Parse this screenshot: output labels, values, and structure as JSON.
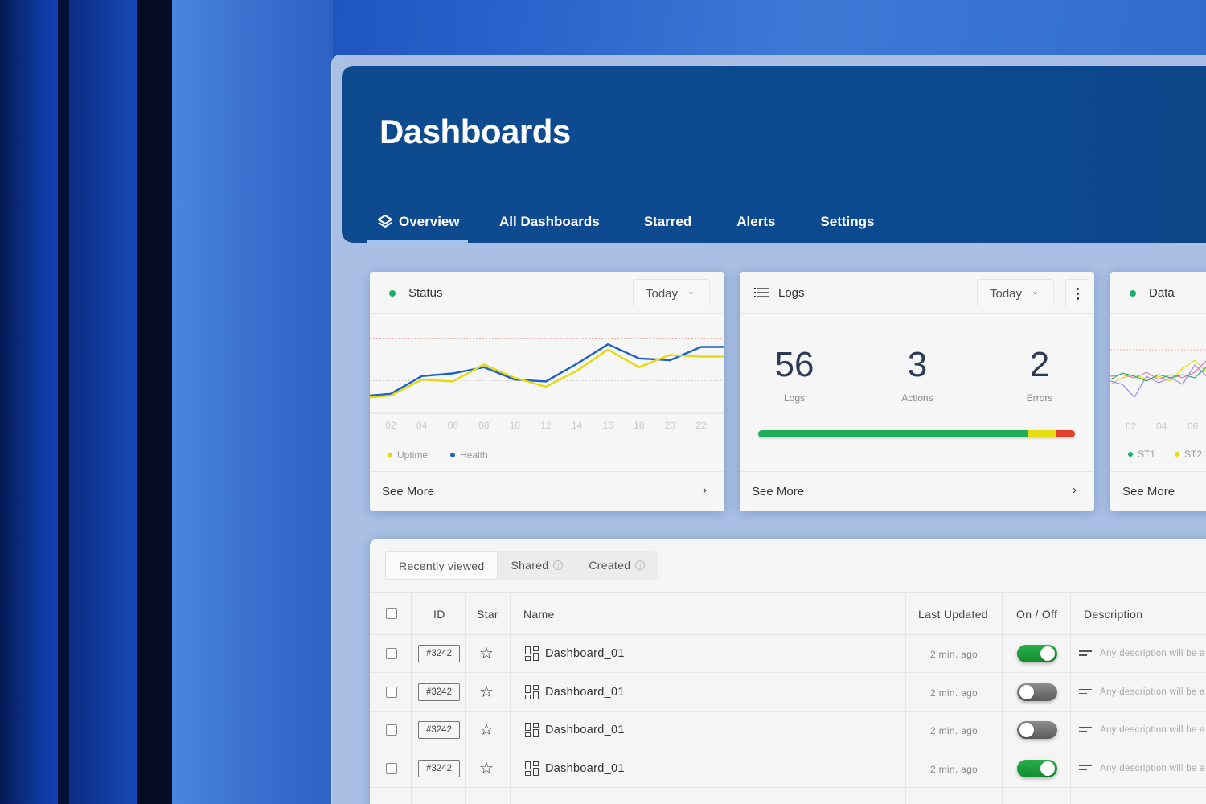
{
  "header": {
    "title": "Dashboards",
    "tabs": [
      {
        "label": "Overview"
      },
      {
        "label": "All Dashboards"
      },
      {
        "label": "Starred"
      },
      {
        "label": "Alerts"
      },
      {
        "label": "Settings"
      }
    ]
  },
  "cards": {
    "status": {
      "title": "Status",
      "range": "Today",
      "x_ticks": [
        "02",
        "04",
        "06",
        "08",
        "10",
        "12",
        "14",
        "16",
        "18",
        "20",
        "22"
      ],
      "legend": [
        "Uptime",
        "Health"
      ],
      "see_more": "See More"
    },
    "logs": {
      "title": "Logs",
      "range": "Today",
      "stats": [
        {
          "value": "56",
          "label": "Logs"
        },
        {
          "value": "3",
          "label": "Actions"
        },
        {
          "value": "2",
          "label": "Errors"
        }
      ],
      "progress": {
        "green": 0.85,
        "yellow": 0.09,
        "red": 0.06
      },
      "see_more": "See More"
    },
    "data": {
      "title": "Data",
      "x_ticks": [
        "02",
        "04",
        "06"
      ],
      "legend": [
        "ST1",
        "ST2"
      ],
      "see_more": "See More"
    }
  },
  "chart_data": {
    "type": "line",
    "x": [
      "02",
      "04",
      "06",
      "08",
      "10",
      "12",
      "14",
      "16",
      "18",
      "20",
      "22"
    ],
    "series": [
      {
        "name": "Uptime",
        "color": "#e3d90f",
        "values": [
          20,
          38,
          36,
          55,
          40,
          30,
          48,
          72,
          52,
          66,
          64
        ]
      },
      {
        "name": "Health",
        "color": "#1f5fc9",
        "values": [
          22,
          42,
          45,
          52,
          38,
          36,
          56,
          78,
          62,
          60,
          75
        ]
      }
    ],
    "ylim": [
      0,
      100
    ],
    "grid": true
  },
  "table": {
    "subtabs": [
      "Recently viewed",
      "Shared",
      "Created"
    ],
    "columns": [
      "ID",
      "Star",
      "Name",
      "Last Updated",
      "On / Off",
      "Description"
    ],
    "rows": [
      {
        "id": "#3242",
        "name": "Dashboard_01",
        "updated": "2 min. ago",
        "on": true,
        "description": "Any description will be a"
      },
      {
        "id": "#3242",
        "name": "Dashboard_01",
        "updated": "2 min. ago",
        "on": false,
        "description": "Any description will be a"
      },
      {
        "id": "#3242",
        "name": "Dashboard_01",
        "updated": "2 min. ago",
        "on": false,
        "description": "Any description will be a"
      },
      {
        "id": "#3242",
        "name": "Dashboard_01",
        "updated": "2 min. ago",
        "on": true,
        "description": "Any description will be a"
      }
    ]
  },
  "colors": {
    "header_bg": "#0e4a8e",
    "accent_green": "#18b06a",
    "toggle_on": "#28b04a",
    "series_uptime": "#e3d90f",
    "series_health": "#1f5fc9"
  }
}
